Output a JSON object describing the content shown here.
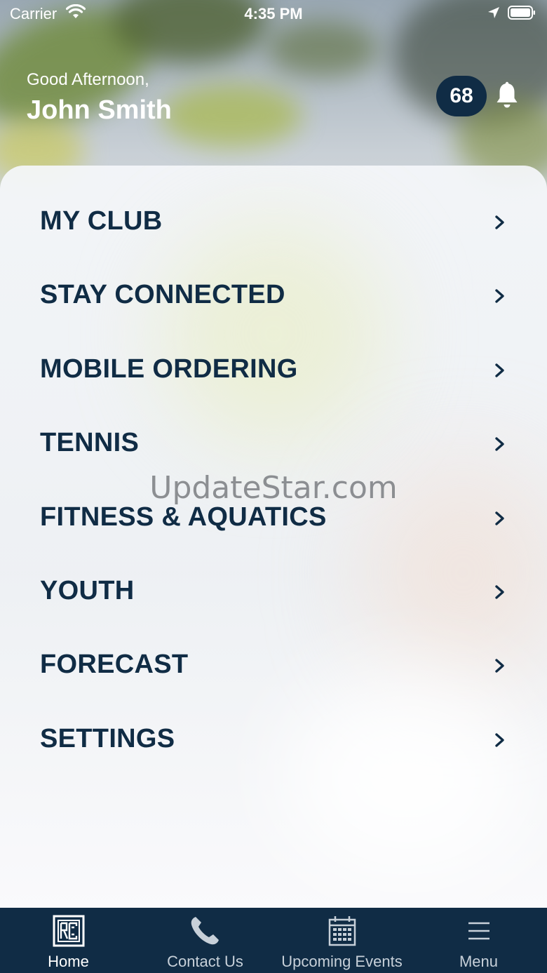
{
  "status_bar": {
    "carrier": "Carrier",
    "time": "4:35 PM",
    "icons": [
      "wifi-icon",
      "location-arrow-icon",
      "battery-icon"
    ]
  },
  "header": {
    "greeting": "Good Afternoon,",
    "user_name": "John Smith",
    "notification_count": "68",
    "notification_icon": "bell-icon"
  },
  "menu": {
    "items": [
      {
        "label": "MY CLUB"
      },
      {
        "label": "STAY CONNECTED"
      },
      {
        "label": "MOBILE ORDERING"
      },
      {
        "label": "TENNIS"
      },
      {
        "label": "FITNESS & AQUATICS"
      },
      {
        "label": "YOUTH"
      },
      {
        "label": "FORECAST"
      },
      {
        "label": "SETTINGS"
      }
    ],
    "chevron_icon": "chevron-right-icon"
  },
  "watermark": "UpdateStar.com",
  "tab_bar": {
    "tabs": [
      {
        "label": "Home",
        "icon": "club-logo-icon",
        "active": true
      },
      {
        "label": "Contact Us",
        "icon": "phone-icon",
        "active": false
      },
      {
        "label": "Upcoming Events",
        "icon": "calendar-icon",
        "active": false
      },
      {
        "label": "Menu",
        "icon": "hamburger-menu-icon",
        "active": false
      }
    ]
  },
  "colors": {
    "primary_navy": "#102c45",
    "text_white": "#ffffff",
    "tab_inactive": "#c7d0d9"
  }
}
